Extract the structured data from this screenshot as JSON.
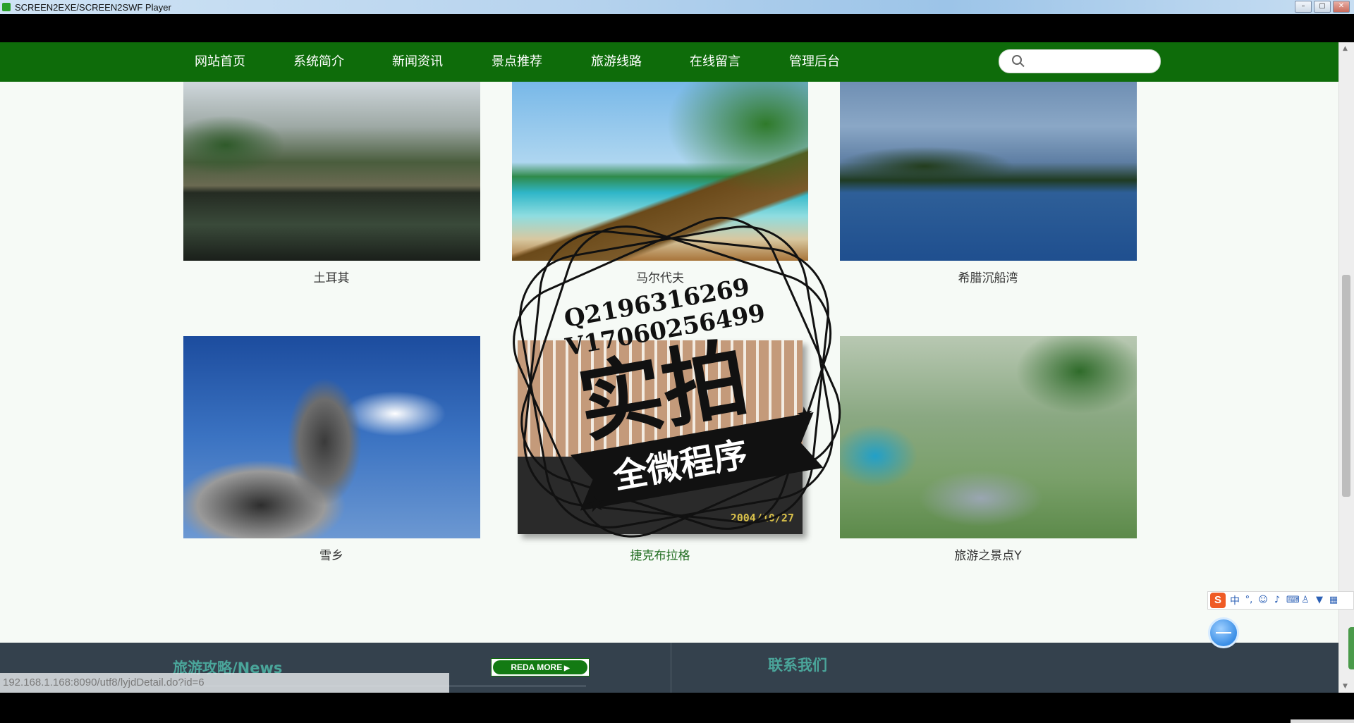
{
  "window": {
    "title": "SCREEN2EXE/SCREEN2SWF Player",
    "controls": [
      "minimize",
      "restore",
      "close"
    ]
  },
  "nav": {
    "items": [
      "网站首页",
      "系统简介",
      "新闻资讯",
      "景点推荐",
      "旅游线路",
      "在线留言",
      "管理后台"
    ],
    "search_placeholder": ""
  },
  "gallery": [
    {
      "caption": "土耳其",
      "image": "lake-mountains-reflection"
    },
    {
      "caption": "马尔代夫",
      "image": "tropical-beach-palm"
    },
    {
      "caption": "希腊沉船湾",
      "image": "blue-bay-boat"
    },
    {
      "caption": "雪乡",
      "image": "snowy-peaks"
    },
    {
      "caption": "捷克布拉格",
      "image": "building-plaza",
      "date_stamp": "2004/10/27"
    },
    {
      "caption": "旅游之景点Y",
      "image": "aerial-campus"
    }
  ],
  "watermark": {
    "line1": "Q2196316269",
    "line2": "V17060256499",
    "big": "实拍",
    "ribbon": "全微程序"
  },
  "footer": {
    "news_title": "旅游攻略/News",
    "read_more": "REDA MORE",
    "contact_title": "联系我们"
  },
  "status_url": "192.168.1.168:8090/utf8/lyjdDetail.do?id=6",
  "ime": {
    "logo": "S",
    "lang": "中"
  },
  "colors": {
    "nav_green": "#0e6c0a",
    "footer_bg": "#34414d",
    "footer_title": "#4aa59a"
  }
}
